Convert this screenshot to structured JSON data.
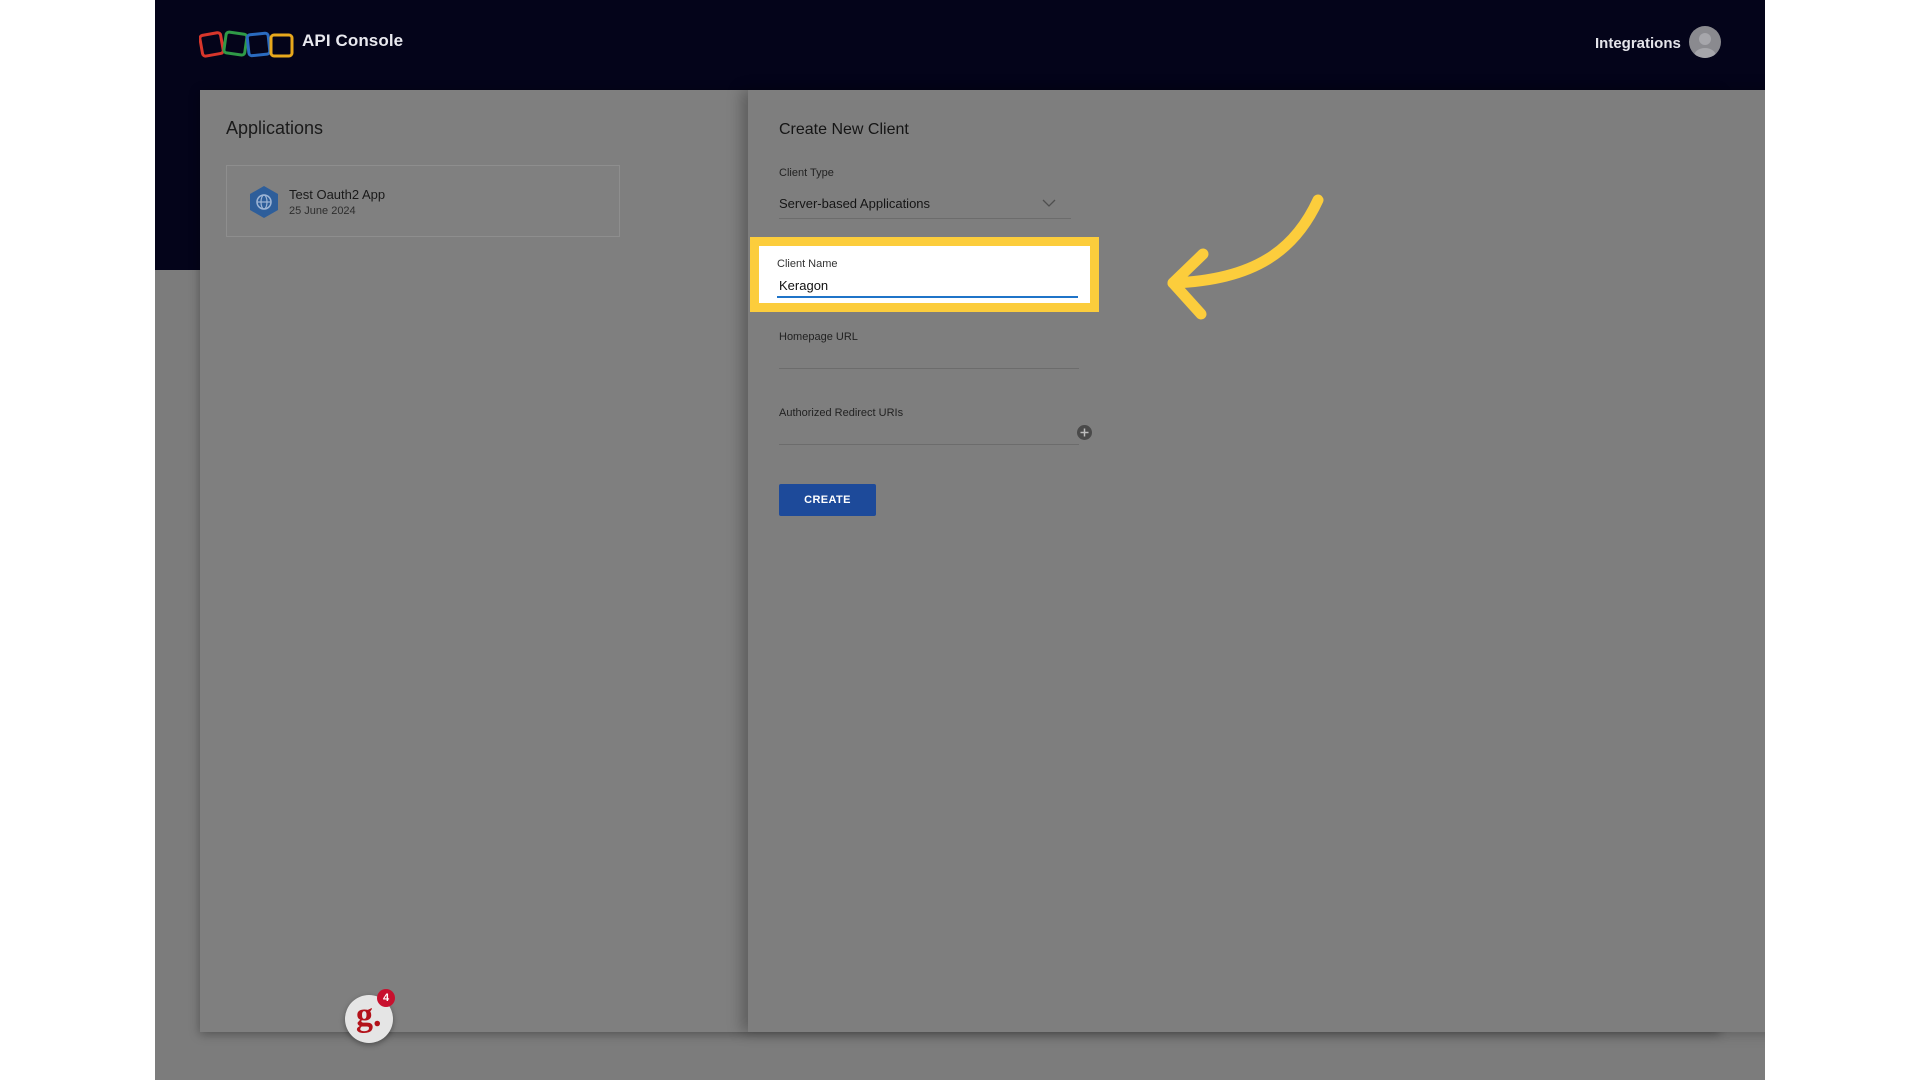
{
  "header": {
    "app_title": "API Console",
    "integrations_label": "Integrations",
    "logo_colors": [
      "#d8362b",
      "#2f9a47",
      "#2a6bc0",
      "#e8a81c"
    ]
  },
  "applications": {
    "title": "Applications",
    "items": [
      {
        "name": "Test Oauth2 App",
        "date": "25 June 2024"
      }
    ]
  },
  "drawer": {
    "title": "Create New Client",
    "client_type": {
      "label": "Client Type",
      "value": "Server-based Applications"
    },
    "client_name": {
      "label": "Client Name",
      "value": "Keragon"
    },
    "homepage_url": {
      "label": "Homepage URL",
      "value": ""
    },
    "redirect_uris": {
      "label": "Authorized Redirect URIs",
      "value": ""
    },
    "create_label": "CREATE"
  },
  "annotation": {
    "highlight_color": "#fccd3c",
    "arrow_color": "#fccd3c"
  },
  "badge": {
    "letter": "g.",
    "count": "4"
  }
}
